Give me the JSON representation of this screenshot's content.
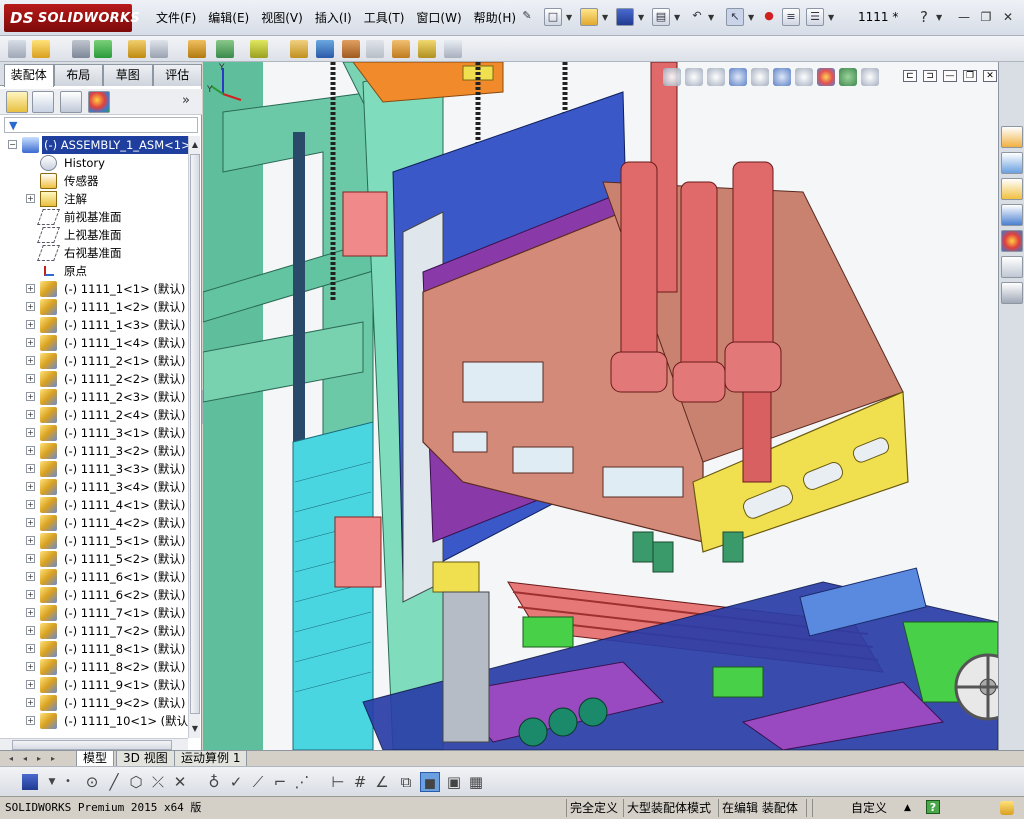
{
  "app": {
    "brand": "SOLIDWORKS",
    "brand_prefix": "DS",
    "doc_title": "1111 *"
  },
  "menu": [
    "文件(F)",
    "编辑(E)",
    "视图(V)",
    "插入(I)",
    "工具(T)",
    "窗口(W)",
    "帮助(H)"
  ],
  "command_manager": {
    "tabs": [
      "装配体",
      "布局",
      "草图",
      "评估"
    ],
    "active": "装配体"
  },
  "feature_tree": {
    "filter_icon": "filter-icon",
    "expand_glyph": "»",
    "root": "(-) ASSEMBLY_1_ASM<1> (",
    "items": [
      {
        "label": "History",
        "icon": "history-icon"
      },
      {
        "label": "传感器",
        "icon": "sensor-icon"
      },
      {
        "label": "注解",
        "icon": "annotation-icon"
      },
      {
        "label": "前视基准面",
        "icon": "plane-icon"
      },
      {
        "label": "上视基准面",
        "icon": "plane-icon"
      },
      {
        "label": "右视基准面",
        "icon": "plane-icon"
      },
      {
        "label": "原点",
        "icon": "origin-icon"
      },
      {
        "label": "(-) 1111_1<1> (默认)",
        "icon": "part-icon"
      },
      {
        "label": "(-) 1111_1<2> (默认)",
        "icon": "part-icon"
      },
      {
        "label": "(-) 1111_1<3> (默认)",
        "icon": "part-icon"
      },
      {
        "label": "(-) 1111_1<4> (默认)",
        "icon": "part-icon"
      },
      {
        "label": "(-) 1111_2<1> (默认)",
        "icon": "part-icon"
      },
      {
        "label": "(-) 1111_2<2> (默认)",
        "icon": "part-icon"
      },
      {
        "label": "(-) 1111_2<3> (默认)",
        "icon": "part-icon"
      },
      {
        "label": "(-) 1111_2<4> (默认)",
        "icon": "part-icon"
      },
      {
        "label": "(-) 1111_3<1> (默认)",
        "icon": "part-icon"
      },
      {
        "label": "(-) 1111_3<2> (默认)",
        "icon": "part-icon"
      },
      {
        "label": "(-) 1111_3<3> (默认)",
        "icon": "part-icon"
      },
      {
        "label": "(-) 1111_3<4> (默认)",
        "icon": "part-icon"
      },
      {
        "label": "(-) 1111_4<1> (默认)",
        "icon": "part-icon"
      },
      {
        "label": "(-) 1111_4<2> (默认)",
        "icon": "part-icon"
      },
      {
        "label": "(-) 1111_5<1> (默认)",
        "icon": "part-icon"
      },
      {
        "label": "(-) 1111_5<2> (默认)",
        "icon": "part-icon"
      },
      {
        "label": "(-) 1111_6<1> (默认)",
        "icon": "part-icon"
      },
      {
        "label": "(-) 1111_6<2> (默认)",
        "icon": "part-icon"
      },
      {
        "label": "(-) 1111_7<1> (默认)",
        "icon": "part-icon"
      },
      {
        "label": "(-) 1111_7<2> (默认)",
        "icon": "part-icon"
      },
      {
        "label": "(-) 1111_8<1> (默认)",
        "icon": "part-icon"
      },
      {
        "label": "(-) 1111_8<2> (默认)",
        "icon": "part-icon"
      },
      {
        "label": "(-) 1111_9<1> (默认)",
        "icon": "part-icon"
      },
      {
        "label": "(-) 1111_9<2> (默认)",
        "icon": "part-icon"
      },
      {
        "label": "(-) 1111_10<1> (默认)",
        "icon": "part-icon"
      }
    ]
  },
  "bottom_tabs": [
    "模型",
    "3D 视图",
    "运动算例 1"
  ],
  "bottom_tabs_active": "模型",
  "status": {
    "app_name": "SOLIDWORKS Premium 2015 x64 版",
    "definition": "完全定义",
    "mode": "大型装配体模式",
    "editing": "在编辑 装配体",
    "units": "自定义",
    "units_arrow": "▲",
    "help_glyph": "?"
  },
  "colors": {
    "frame_green": "#6cc9a8",
    "plate_brown": "#d48a78",
    "spindle_red": "#e06a6a",
    "frame_yellow": "#f0e050",
    "plate_purple": "#8a3aa8",
    "conveyor_blue": "#2a3ea8",
    "selection_blue": "#1f3f9e"
  }
}
